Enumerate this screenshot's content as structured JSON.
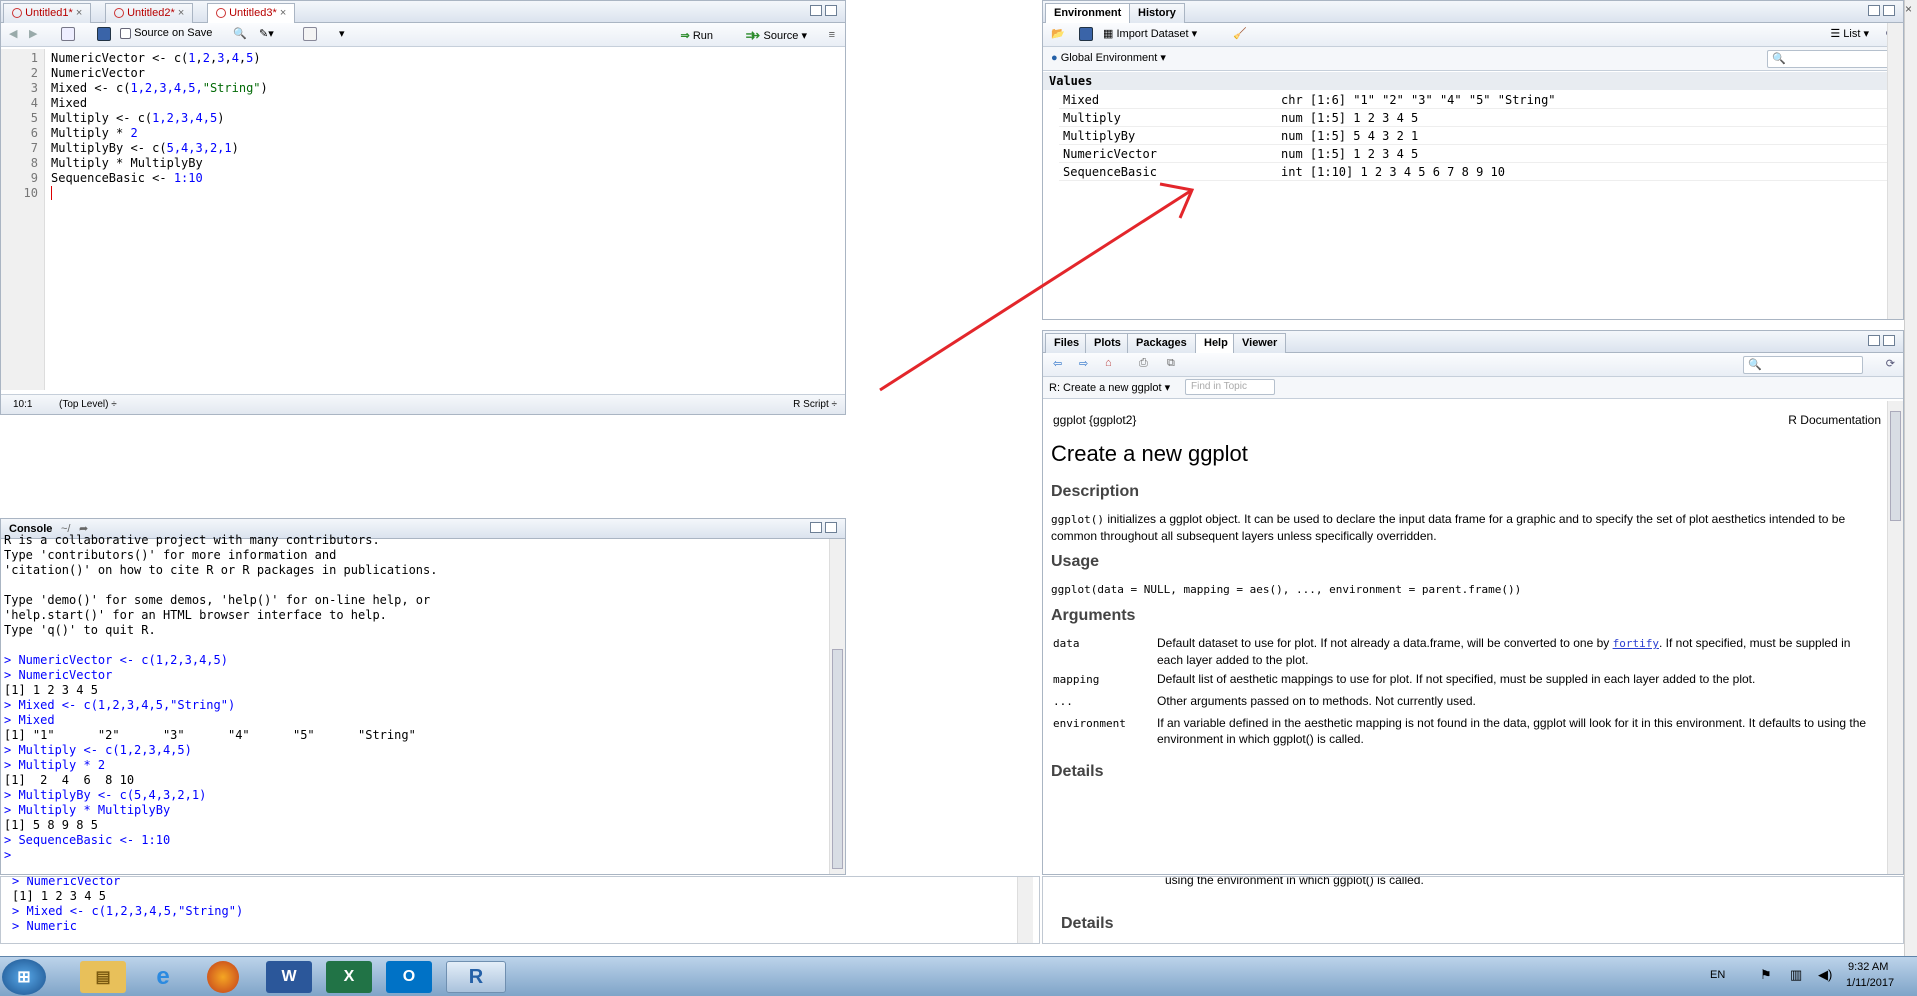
{
  "editor": {
    "tabs": [
      "Untitled1*",
      "Untitled2*",
      "Untitled3*"
    ],
    "source_on_save": "Source on Save",
    "run": "Run",
    "source": "Source",
    "lines": [
      {
        "n": "1",
        "parts": [
          {
            "t": "NumericVector <- c("
          },
          {
            "t": "1",
            "c": "num"
          },
          {
            "t": ","
          },
          {
            "t": "2",
            "c": "num"
          },
          {
            "t": ","
          },
          {
            "t": "3",
            "c": "num"
          },
          {
            "t": ","
          },
          {
            "t": "4",
            "c": "num"
          },
          {
            "t": ","
          },
          {
            "t": "5",
            "c": "num"
          },
          {
            "t": ")"
          }
        ]
      },
      {
        "n": "2",
        "parts": [
          {
            "t": "NumericVector"
          }
        ]
      },
      {
        "n": "3",
        "parts": [
          {
            "t": "Mixed <- c("
          },
          {
            "t": "1,2,3,4,5,",
            "c": "num"
          },
          {
            "t": "\"String\"",
            "c": "str"
          },
          {
            "t": ")"
          }
        ]
      },
      {
        "n": "4",
        "parts": [
          {
            "t": "Mixed"
          }
        ]
      },
      {
        "n": "5",
        "parts": [
          {
            "t": "Multiply <- c("
          },
          {
            "t": "1,2,3,4,5",
            "c": "num"
          },
          {
            "t": ")"
          }
        ]
      },
      {
        "n": "6",
        "parts": [
          {
            "t": "Multiply * "
          },
          {
            "t": "2",
            "c": "num"
          }
        ]
      },
      {
        "n": "7",
        "parts": [
          {
            "t": "MultiplyBy <- c("
          },
          {
            "t": "5,4,3,2,1",
            "c": "num"
          },
          {
            "t": ")"
          }
        ]
      },
      {
        "n": "8",
        "parts": [
          {
            "t": "Multiply * MultiplyBy"
          }
        ]
      },
      {
        "n": "9",
        "parts": [
          {
            "t": "SequenceBasic <- "
          },
          {
            "t": "1:10",
            "c": "num"
          }
        ]
      },
      {
        "n": "10",
        "parts": []
      }
    ],
    "status_pos": "10:1",
    "status_level": "(Top Level) ÷",
    "status_type": "R Script ÷"
  },
  "console": {
    "title": "Console",
    "path": "~/",
    "lines": [
      {
        "t": "R is a collaborative project with many contributors.",
        "c": ""
      },
      {
        "t": "Type 'contributors()' for more information and",
        "c": ""
      },
      {
        "t": "'citation()' on how to cite R or R packages in publications.",
        "c": ""
      },
      {
        "t": "",
        "c": ""
      },
      {
        "t": "Type 'demo()' for some demos, 'help()' for on-line help, or",
        "c": ""
      },
      {
        "t": "'help.start()' for an HTML browser interface to help.",
        "c": ""
      },
      {
        "t": "Type 'q()' to quit R.",
        "c": ""
      },
      {
        "t": "",
        "c": ""
      },
      {
        "t": "> NumericVector <- c(1,2,3,4,5)",
        "c": "cmd"
      },
      {
        "t": "> NumericVector",
        "c": "cmd"
      },
      {
        "t": "[1] 1 2 3 4 5",
        "c": ""
      },
      {
        "t": "> Mixed <- c(1,2,3,4,5,\"String\")",
        "c": "cmd"
      },
      {
        "t": "> Mixed",
        "c": "cmd"
      },
      {
        "t": "[1] \"1\"      \"2\"      \"3\"      \"4\"      \"5\"      \"String\"",
        "c": ""
      },
      {
        "t": "> Multiply <- c(1,2,3,4,5)",
        "c": "cmd"
      },
      {
        "t": "> Multiply * 2",
        "c": "cmd"
      },
      {
        "t": "[1]  2  4  6  8 10",
        "c": ""
      },
      {
        "t": "> MultiplyBy <- c(5,4,3,2,1)",
        "c": "cmd"
      },
      {
        "t": "> Multiply * MultiplyBy",
        "c": "cmd"
      },
      {
        "t": "[1] 5 8 9 8 5",
        "c": ""
      },
      {
        "t": "> SequenceBasic <- 1:10",
        "c": "cmd"
      },
      {
        "t": "> ",
        "c": "cmd"
      }
    ],
    "overlay_lines": [
      {
        "t": "> NumericVector",
        "c": "cmd"
      },
      {
        "t": "[1] 1 2 3 4 5",
        "c": ""
      },
      {
        "t": "> Mixed <- c(1,2,3,4,5,\"String\")",
        "c": "cmd"
      },
      {
        "t": "> Numeric",
        "c": "cmd"
      }
    ]
  },
  "env": {
    "tabs": [
      "Environment",
      "History"
    ],
    "import": "Import Dataset",
    "list": "List",
    "scope": "Global Environment",
    "section": "Values",
    "rows": [
      {
        "name": "Mixed",
        "value": "chr [1:6] \"1\" \"2\" \"3\" \"4\" \"5\" \"String\""
      },
      {
        "name": "Multiply",
        "value": "num [1:5] 1 2 3 4 5"
      },
      {
        "name": "MultiplyBy",
        "value": "num [1:5] 5 4 3 2 1"
      },
      {
        "name": "NumericVector",
        "value": "num [1:5] 1 2 3 4 5"
      },
      {
        "name": "SequenceBasic",
        "value": "int [1:10] 1 2 3 4 5 6 7 8 9 10"
      }
    ]
  },
  "help": {
    "tabs": [
      "Files",
      "Plots",
      "Packages",
      "Help",
      "Viewer"
    ],
    "topic": "R: Create a new ggplot",
    "find_placeholder": "Find in Topic",
    "pkg": "ggplot {ggplot2}",
    "rdoc": "R Documentation",
    "title": "Create a new ggplot",
    "desc_h": "Description",
    "desc_code": "ggplot()",
    "desc_text": " initializes a ggplot object. It can be used to declare the input data frame for a graphic and to specify the set of plot aesthetics intended to be common throughout all subsequent layers unless specifically overridden.",
    "usage_h": "Usage",
    "usage_code": "ggplot(data = NULL, mapping = aes(), ..., environment = parent.frame())",
    "args_h": "Arguments",
    "args": [
      {
        "name": "data",
        "text1": "Default dataset to use for plot. If not already a data.frame, will be converted to one by ",
        "link": "fortify",
        "text2": ". If not specified, must be suppled in each layer added to the plot."
      },
      {
        "name": "mapping",
        "text1": "Default list of aesthetic mappings to use for plot. If not specified, must be suppled in each layer added to the plot.",
        "link": "",
        "text2": ""
      },
      {
        "name": "...",
        "text1": "Other arguments passed on to methods. Not currently used.",
        "link": "",
        "text2": ""
      },
      {
        "name": "environment",
        "text1": "If an variable defined in the aesthetic mapping is not found in the data, ggplot will look for it in this environment. It defaults to using the environment in which ",
        "link": "",
        "text2": "ggplot() is called."
      }
    ],
    "details_h": "Details",
    "overlay_text": "using the environment in which ggplot() is called.",
    "overlay_details": "Details"
  },
  "taskbar": {
    "lang": "EN",
    "time": "9:32 AM",
    "date": "1/11/2017"
  },
  "colors": {
    "arrow": "#e3262b",
    "cmd": "#0000ff"
  }
}
